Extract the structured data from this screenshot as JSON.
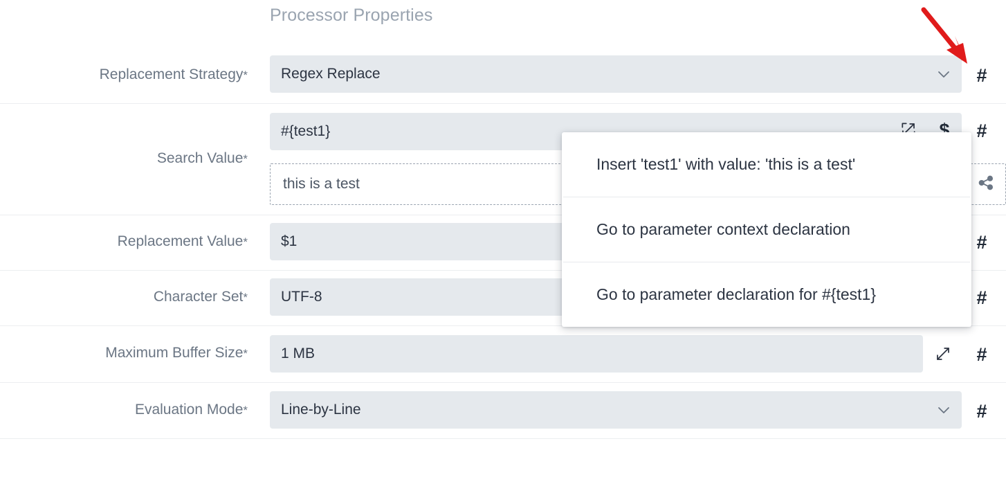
{
  "panel": {
    "title": "Processor Properties"
  },
  "properties": [
    {
      "label": "Replacement Strategy",
      "required": "*",
      "value": "Regex Replace",
      "control": "select",
      "gutter_icon": "hash-icon",
      "gutter_label": "#"
    },
    {
      "label": "Search Value",
      "required": "*",
      "value": "#{test1}",
      "control": "text",
      "preview": "this is a test",
      "expand_icon": "expand-icon",
      "dollar_icon": "dollar-icon",
      "dollar_label": "$",
      "share_icon": "share-icon",
      "gutter_icon": "hash-icon",
      "gutter_label": "#"
    },
    {
      "label": "Replacement Value",
      "required": "*",
      "value": "$1",
      "control": "text",
      "gutter_icon": "hash-icon",
      "gutter_label": "#"
    },
    {
      "label": "Character Set",
      "required": "*",
      "value": "UTF-8",
      "control": "text",
      "gutter_icon": "hash-icon",
      "gutter_label": "#"
    },
    {
      "label": "Maximum Buffer Size",
      "required": "*",
      "value": "1 MB",
      "control": "text",
      "expand_icon": "expand-icon",
      "gutter_icon": "hash-icon",
      "gutter_label": "#"
    },
    {
      "label": "Evaluation Mode",
      "required": "*",
      "value": "Line-by-Line",
      "control": "select",
      "gutter_icon": "hash-icon",
      "gutter_label": "#"
    }
  ],
  "context_menu": {
    "items": [
      {
        "label": "Insert 'test1' with value: 'this is a test'"
      },
      {
        "label": "Go to parameter context declaration"
      },
      {
        "label": "Go to parameter declaration for #{test1}"
      }
    ]
  },
  "annotation": {
    "arrow_color": "#e01b1b",
    "name": "red-pointer-arrow"
  },
  "colors": {
    "field_bg": "#e5e9ed",
    "label_text": "#6b7684",
    "value_text": "#2c3442",
    "title_text": "#9aa4b0",
    "divider": "#eceef0"
  }
}
